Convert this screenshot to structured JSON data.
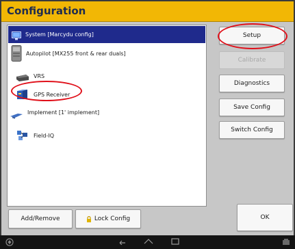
{
  "window": {
    "title": "Configuration"
  },
  "tree": {
    "items": [
      {
        "label": "System [Marcydu config]",
        "icon": "monitor-icon",
        "selected": true
      },
      {
        "label": "Autopilot [MX255 front & rear duals]",
        "icon": "autopilot-controller-icon",
        "selected": false
      },
      {
        "label": "VRS",
        "icon": "vrs-receiver-icon",
        "selected": false
      },
      {
        "label": "GPS Receiver",
        "icon": "gps-receiver-icon",
        "selected": false
      },
      {
        "label": "Implement [1' implement]",
        "icon": "implement-icon",
        "selected": false
      },
      {
        "label": "Field-IQ",
        "icon": "field-iq-icon",
        "selected": false
      }
    ]
  },
  "side_buttons": {
    "setup": "Setup",
    "calibrate": "Calibrate",
    "diagnostics": "Diagnostics",
    "save_config": "Save Config",
    "switch_config": "Switch Config"
  },
  "bottom_buttons": {
    "add_remove": "Add/Remove",
    "lock_config": "Lock Config",
    "ok": "OK"
  },
  "colors": {
    "title_bar": "#f2b705",
    "title_text": "#1d2b4f",
    "selection": "#1f2a8c",
    "highlight_oval": "#e0101a"
  }
}
